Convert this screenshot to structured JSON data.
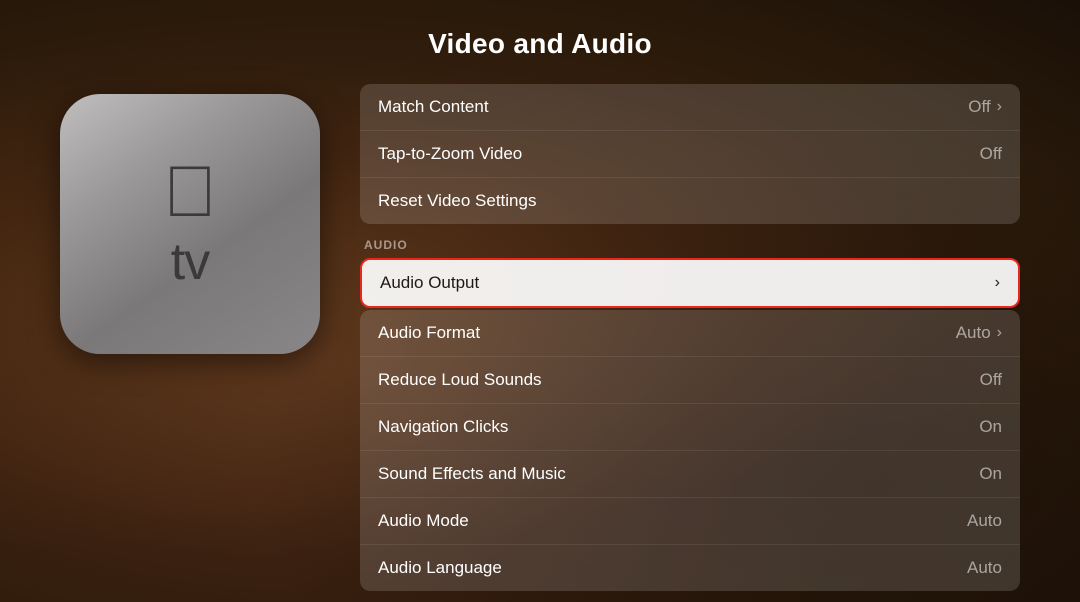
{
  "page": {
    "title": "Video and Audio"
  },
  "appletv": {
    "logo": "",
    "tv_label": "tv"
  },
  "sections": {
    "video_section_label": "",
    "audio_section_label": "AUDIO"
  },
  "video_rows": [
    {
      "id": "match-content",
      "label": "Match Content",
      "value": "Off",
      "has_chevron": true
    },
    {
      "id": "tap-to-zoom",
      "label": "Tap-to-Zoom Video",
      "value": "Off",
      "has_chevron": false
    },
    {
      "id": "reset-video",
      "label": "Reset Video Settings",
      "value": "",
      "has_chevron": false
    }
  ],
  "audio_rows": [
    {
      "id": "audio-output",
      "label": "Audio Output",
      "value": "",
      "has_chevron": true,
      "selected": true
    },
    {
      "id": "audio-format",
      "label": "Audio Format",
      "value": "Auto",
      "has_chevron": true,
      "selected": false
    },
    {
      "id": "reduce-loud",
      "label": "Reduce Loud Sounds",
      "value": "Off",
      "has_chevron": false,
      "selected": false
    },
    {
      "id": "nav-clicks",
      "label": "Navigation Clicks",
      "value": "On",
      "has_chevron": false,
      "selected": false
    },
    {
      "id": "sound-effects",
      "label": "Sound Effects and Music",
      "value": "On",
      "has_chevron": false,
      "selected": false
    },
    {
      "id": "audio-mode",
      "label": "Audio Mode",
      "value": "Auto",
      "has_chevron": false,
      "selected": false
    },
    {
      "id": "audio-language",
      "label": "Audio Language",
      "value": "Auto",
      "has_chevron": false,
      "selected": false
    }
  ],
  "icons": {
    "chevron": "›"
  }
}
